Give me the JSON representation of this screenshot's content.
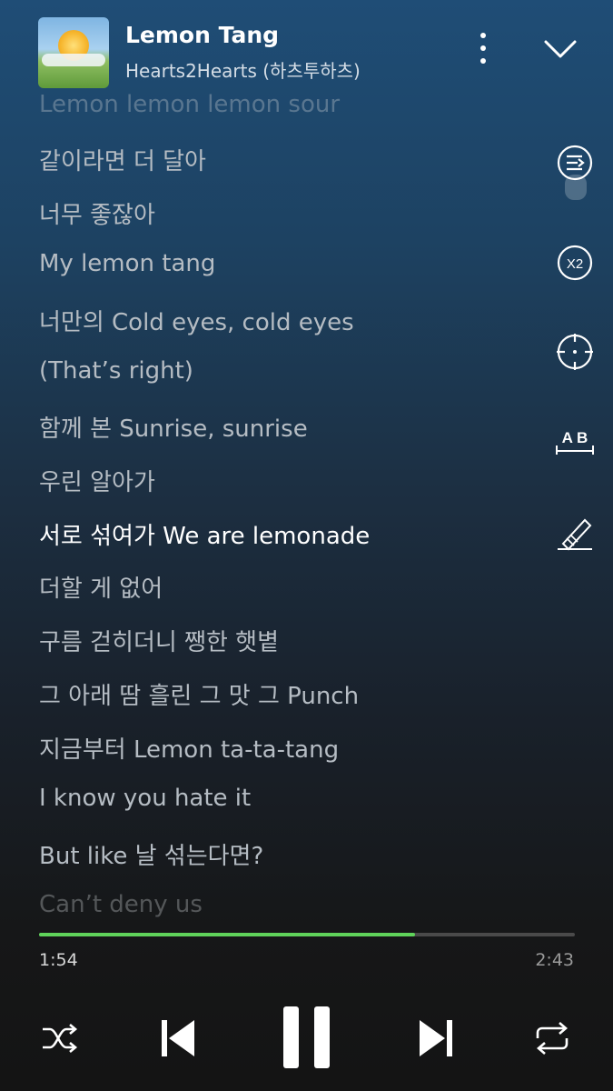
{
  "track": {
    "title": "Lemon Tang",
    "artist": "Hearts2Hearts (하츠투하츠)"
  },
  "lyrics": [
    {
      "text": "Lemon lemon lemon sour",
      "state": "faded"
    },
    {
      "text": "같이라면 더 달아",
      "state": "normal"
    },
    {
      "text": "너무 좋잖아",
      "state": "normal"
    },
    {
      "text": "My lemon tang",
      "state": "normal"
    },
    {
      "text": "너만의 Cold eyes, cold eyes",
      "state": "normal"
    },
    {
      "text": "(That’s right)",
      "state": "normal"
    },
    {
      "text": "함께 본 Sunrise, sunrise",
      "state": "normal"
    },
    {
      "text": "우린 알아가",
      "state": "normal"
    },
    {
      "text": "서로 섞여가 We are lemonade",
      "state": "current"
    },
    {
      "text": "더할 게 없어",
      "state": "normal"
    },
    {
      "text": "구름 걷히더니 쨍한 햇볕",
      "state": "normal"
    },
    {
      "text": "그 아래 땀 흘린 그 맛 그 Punch",
      "state": "normal"
    },
    {
      "text": "지금부터 Lemon ta-ta-tang",
      "state": "normal"
    },
    {
      "text": "I know you hate it",
      "state": "normal"
    },
    {
      "text": "But like 날 섞는다면?",
      "state": "normal"
    },
    {
      "text": "Can’t deny us",
      "state": "faded"
    }
  ],
  "side_tools": {
    "speed_label": "X2",
    "translate_label": "A B"
  },
  "player": {
    "elapsed": "1:54",
    "total": "2:43",
    "progress": 0.701
  },
  "icons": [
    "more-vertical-icon",
    "chevron-down-icon",
    "queue-icon",
    "speed-icon",
    "locate-icon",
    "translate-icon",
    "edit-icon",
    "shuffle-icon",
    "previous-icon",
    "pause-icon",
    "next-icon",
    "repeat-icon"
  ],
  "colors": {
    "progress_fill": "#5fd35a",
    "current_lyric": "#ffffff",
    "lyric": "#b5bcc3"
  }
}
